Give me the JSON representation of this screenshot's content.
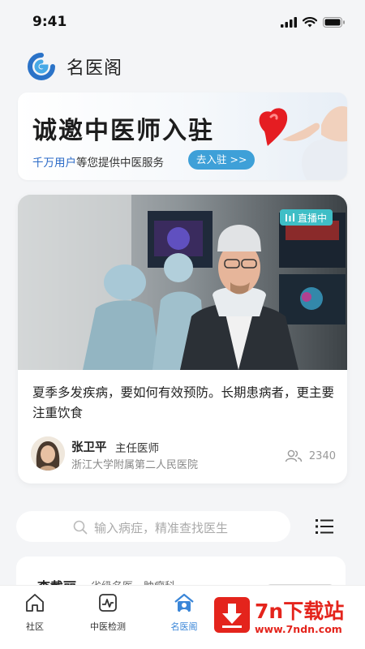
{
  "status_bar": {
    "time": "9:41"
  },
  "header": {
    "title": "名医阁"
  },
  "banner": {
    "title": "诚邀中医师入驻",
    "subtitle_highlight": "千万用户",
    "subtitle_rest": "等您提供中医服务",
    "button_label": "去入驻 >>"
  },
  "live_card": {
    "badge": "直播中",
    "description": "夏季多发疾病，要如何有效预防。长期患病者，更主要注重饮食",
    "doctor_name": "张卫平",
    "doctor_title": "主任医师",
    "hospital": "浙江大学附属第二人民医院",
    "view_count": "2340"
  },
  "search": {
    "placeholder": "输入病症，精准查找医生"
  },
  "doctor_preview": {
    "name": "李戴丽",
    "tags": "省级名医　肿瘤科"
  },
  "tabbar": {
    "tabs": [
      {
        "label": "社区",
        "icon": "home-icon",
        "active": false
      },
      {
        "label": "中医检测",
        "icon": "pulse-chart-icon",
        "active": false
      },
      {
        "label": "名医阁",
        "icon": "doctor-house-icon",
        "active": true
      }
    ]
  },
  "watermark": {
    "title": "7n下载站",
    "url": "www.7ndn.com"
  },
  "colors": {
    "accent": "#3a86d8",
    "live_badge": "#3fbec6",
    "banner_button": "#3ea0d8",
    "watermark": "#e4241c"
  }
}
